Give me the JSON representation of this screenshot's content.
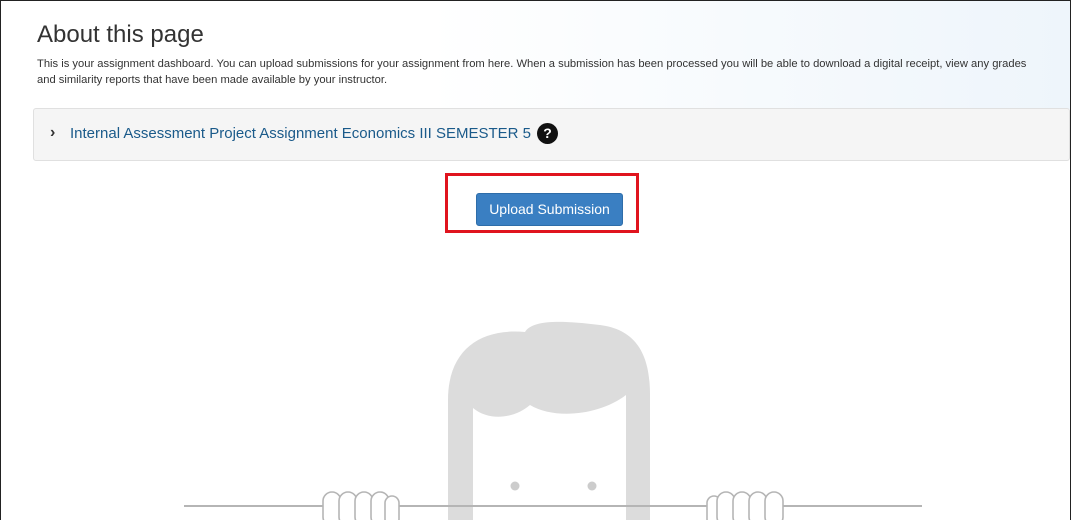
{
  "about": {
    "title": "About this page",
    "description": "This is your assignment dashboard. You can upload submissions for your assignment from here. When a submission has been processed you will be able to download a digital receipt, view any grades and similarity reports that have been made available by your instructor."
  },
  "assignment": {
    "title": "Internal Assessment Project Assignment Economics III SEMESTER 5",
    "expand_icon": "chevron-right-icon",
    "help_icon": "question-circle-icon",
    "help_glyph": "?"
  },
  "actions": {
    "upload_label": "Upload Submission"
  },
  "colors": {
    "primary_button": "#3a7fc2",
    "highlight_border": "#e0141e",
    "link_text": "#1a5a8a"
  }
}
